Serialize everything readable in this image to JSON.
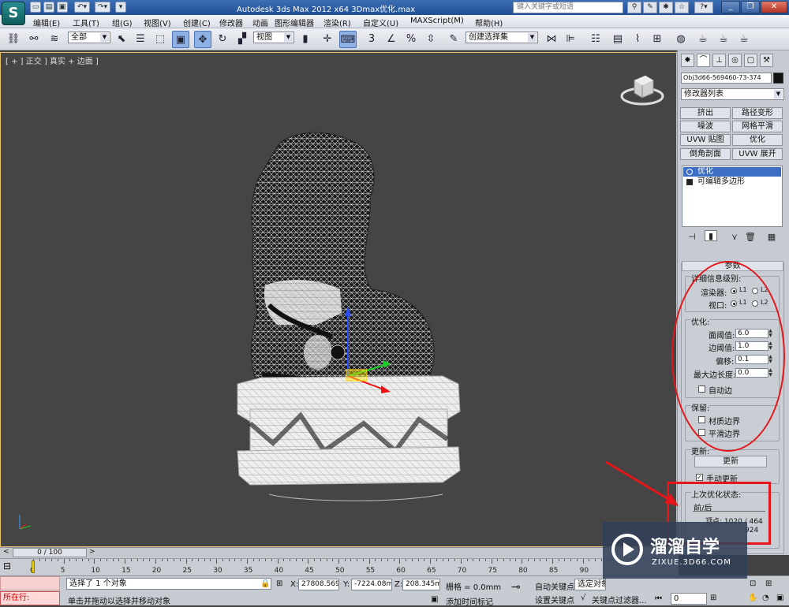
{
  "app": {
    "title": "Autodesk 3ds Max  2012 x64      3Dmax优化.max",
    "search_placeholder": "键入关键字或短语"
  },
  "menu": [
    "编辑(E)",
    "工具(T)",
    "组(G)",
    "视图(V)",
    "创建(C)",
    "修改器",
    "动画",
    "图形编辑器",
    "渲染(R)",
    "自定义(U)",
    "MAXScript(M)",
    "帮助(H)"
  ],
  "toolbar": {
    "selection_filter": "全部",
    "ref_coord": "视图",
    "named_selection": "创建选择集"
  },
  "viewport": {
    "label": "[ + ] 正交 ] 真实 + 边面 ]"
  },
  "panel": {
    "object_name": "Obj3d66-569460-73-374",
    "modifier_list": "修改器列表",
    "mod_buttons": [
      "挤出",
      "路径变形",
      "噪波",
      "网格平滑",
      "UVW 贴图",
      "优化",
      "倒角剖面",
      "UVW 展开"
    ],
    "stack": [
      "优化",
      "可编辑多边形"
    ],
    "rollout_title": "参数",
    "detail_group": "详细信息级别:",
    "renderer_label": "渲染器:",
    "viewport_label": "视口:",
    "l1": "L1",
    "l2": "L2",
    "optimize_group": "优化:",
    "face_threshold_label": "面阈值:",
    "face_threshold": "6.0",
    "edge_threshold_label": "边阈值:",
    "edge_threshold": "1.0",
    "bias_label": "偏移:",
    "bias": "0.1",
    "max_edge_label": "最大边长度:",
    "max_edge": "0.0",
    "auto_edge": "自动边",
    "preserve_group": "保留:",
    "material_boundaries": "材质边界",
    "smooth_boundaries": "平滑边界",
    "update_group": "更新:",
    "update_button": "更新",
    "manual_update": "手动更新",
    "last_opt_group": "上次优化状态:",
    "before_after": "前/后",
    "vertices": "顶点: 1020 / 464",
    "faces_tail": "924"
  },
  "timeline": {
    "slider": "0 / 100",
    "ticks": [
      "0",
      "5",
      "10",
      "15",
      "20",
      "25",
      "30",
      "35",
      "40",
      "45",
      "50",
      "55",
      "60",
      "65",
      "70",
      "75",
      "80",
      "85",
      "90"
    ]
  },
  "status": {
    "running": "所在行:",
    "selected": "选择了 1 个对象",
    "prompt": "单击并拖动以选择并移动对象",
    "x_label": "X:",
    "x": "27808.569",
    "y_label": "Y:",
    "y": "-7224.08m",
    "z_label": "Z:",
    "z": "208.345mr",
    "grid": "栅格 = 0.0mm",
    "autokey": "自动关键点",
    "selected_set": "选定对象",
    "setkey": "设置关键点",
    "keyfilter": "关键点过滤器...",
    "add_time_tag": "添加时间标记",
    "frame": "0"
  },
  "watermark": {
    "name": "溜溜自学",
    "url": "ZIXUE.3D66.COM"
  },
  "colors": {
    "accent": "#3c6fc4",
    "annotation": "#e5161a",
    "viewport_border": "#e9c36b"
  }
}
